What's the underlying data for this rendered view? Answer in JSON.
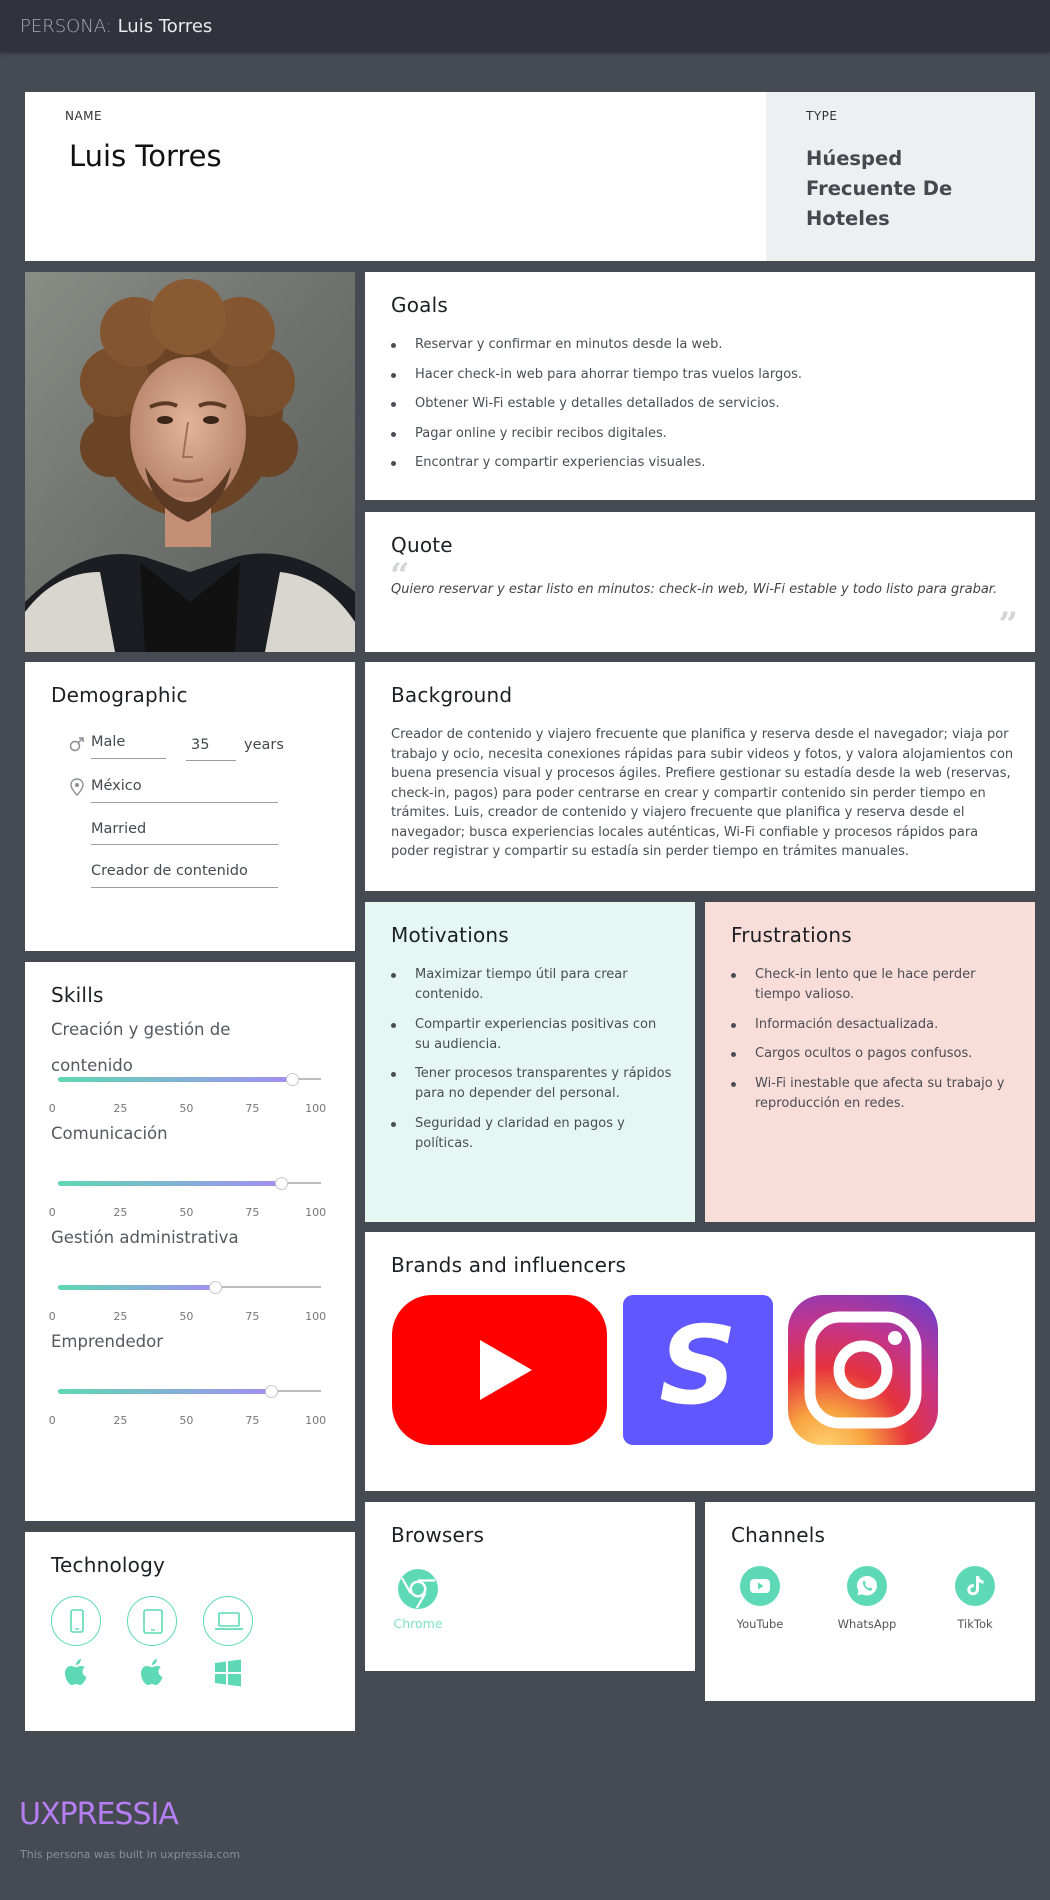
{
  "header": {
    "prefix": "PERSONA:",
    "name": "Luis Torres"
  },
  "name_card": {
    "label": "NAME",
    "value": "Luis Torres"
  },
  "type_card": {
    "label": "TYPE",
    "lines": [
      "Húesped",
      "Frecuente De",
      "Hoteles"
    ]
  },
  "goals": {
    "title": "Goals",
    "items": [
      "Reservar y confirmar en minutos desde la web.",
      "Hacer check-in web para ahorrar tiempo tras vuelos largos.",
      "Obtener Wi-Fi estable y detalles detallados de servicios.",
      "Pagar online y recibir recibos digitales.",
      "Encontrar y compartir experiencias visuales."
    ]
  },
  "quote": {
    "title": "Quote",
    "text": "Quiero reservar y estar listo en minutos: check-in web, Wi-Fi estable y todo listo para grabar."
  },
  "demographic": {
    "title": "Demographic",
    "gender": "Male",
    "age": "35",
    "age_unit": "years",
    "location": "México",
    "status": "Married",
    "occupation": "Creador de contenido"
  },
  "background": {
    "title": "Background",
    "text": "Creador de contenido y viajero frecuente que planifica y reserva desde el navegador; viaja por trabajo y ocio, necesita conexiones rápidas para subir videos y fotos, y valora alojamientos con buena presencia visual y procesos ágiles. Prefiere gestionar su estadía desde la web (reservas, check-in, pagos) para poder centrarse en crear y compartir contenido sin perder tiempo en trámites. Luis, creador de contenido y viajero frecuente que planifica y reserva desde el navegador; busca experiencias locales auténticas, Wi-Fi confiable y procesos rápidos para poder registrar y compartir su estadía sin perder tiempo en trámites manuales."
  },
  "motivations": {
    "title": "Motivations",
    "items": [
      "Maximizar tiempo útil para crear contenido.",
      "Compartir experiencias positivas con su audiencia.",
      "Tener procesos transparentes y rápidos para no depender del personal.",
      "Seguridad y claridad en pagos y políticas."
    ]
  },
  "frustrations": {
    "title": "Frustrations",
    "items": [
      "Check-in lento  que le hace perder tiempo valioso.",
      "Información desactualizada.",
      "Cargos ocultos o pagos confusos.",
      "Wi-Fi inestable que afecta su trabajo y reproducción en redes."
    ]
  },
  "skills": {
    "title": "Skills",
    "ticks": [
      "0",
      "25",
      "50",
      "75",
      "100"
    ],
    "items": [
      {
        "name": "Creación y gestión de contenido",
        "value": 89
      },
      {
        "name": "Comunicación",
        "value": 85
      },
      {
        "name": "Gestión administrativa",
        "value": 60
      },
      {
        "name": "Emprendedor",
        "value": 81
      }
    ]
  },
  "brands": {
    "title": "Brands and influencers",
    "items": [
      "youtube-logo",
      "stan-logo",
      "instagram-logo"
    ],
    "stan_letter": "S"
  },
  "technology": {
    "title": "Technology",
    "devices": [
      "smartphone-icon",
      "tablet-icon",
      "laptop-icon"
    ],
    "platforms": [
      "apple-icon",
      "apple-icon",
      "windows-icon"
    ]
  },
  "browsers": {
    "title": "Browsers",
    "items": [
      {
        "name": "Chrome"
      }
    ]
  },
  "channels": {
    "title": "Channels",
    "items": [
      {
        "name": "YouTube"
      },
      {
        "name": "WhatsApp"
      },
      {
        "name": "TikTok"
      }
    ]
  },
  "footer": {
    "brand": "UXPRESSIA",
    "note": "This persona was built in uxpressia.com"
  },
  "colors": {
    "accent": "#5ddab5",
    "motivations_bg": "#e4f7f2",
    "frustrations_bg": "#f9ddd9",
    "footer_brand": "#b57ff3"
  }
}
